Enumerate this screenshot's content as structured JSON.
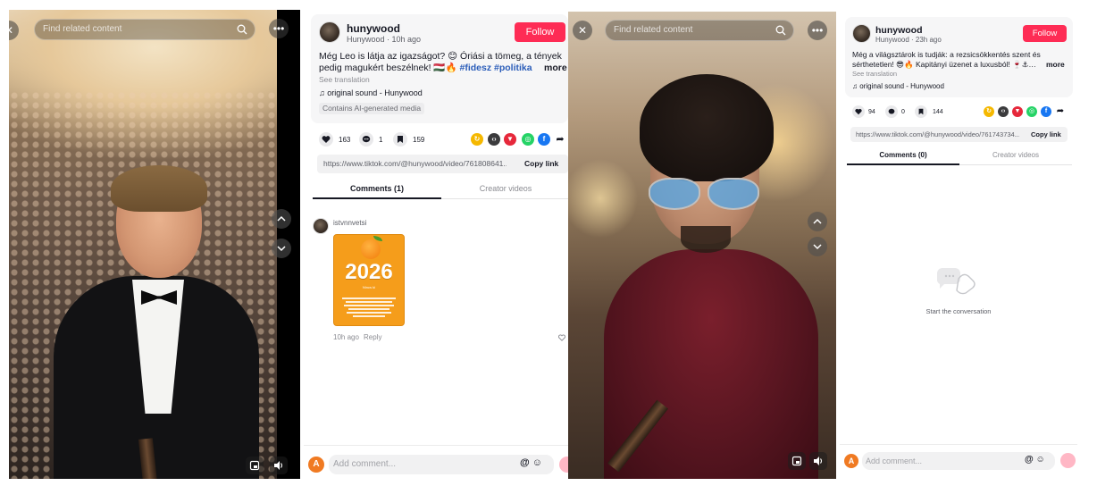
{
  "left": {
    "video": {
      "search_placeholder": "Find related content"
    },
    "author": {
      "name": "hunywood",
      "sub": "Hunywood · 10h ago",
      "follow_label": "Follow"
    },
    "caption": {
      "text": "Még Leo is látja az igazságot? 😊 Óriási a tömeg, a tények pedig magukért beszélnek! 🇭🇺🔥 ",
      "tags": "#fidesz #politika #budapest…",
      "more": "more",
      "see_translation": "See translation"
    },
    "sound": "♫  original sound - Hunywood",
    "ai_label": "Contains AI-generated media",
    "actions": {
      "likes": "163",
      "comments": "1",
      "saves": "159"
    },
    "link": {
      "url": "https://www.tiktok.com/@hunywood/video/761808641...",
      "copy": "Copy link"
    },
    "tabs": [
      "Comments (1)",
      "Creator videos"
    ],
    "comment": {
      "user": "istvnnvetsi",
      "sticker_year": "2026",
      "sticker_small": "Nincs ki",
      "time": "10h ago",
      "reply": "Reply"
    },
    "composer": {
      "avatar": "A",
      "placeholder": "Add comment...",
      "emoji": "@ ☺"
    }
  },
  "right": {
    "video": {
      "search_placeholder": "Find related content"
    },
    "author": {
      "name": "hunywood",
      "sub": "Hunywood · 23h ago",
      "follow_label": "Follow"
    },
    "caption": {
      "text": "Még a világsztárok is tudják: a rezsicsökkentés szent és sérthetetlen! 😎🔥 Kapitányi üzenet a luxusból! 🍷⚓…",
      "more": "more",
      "see_translation": "See translation"
    },
    "sound": "♫  original sound - Hunywood",
    "actions": {
      "likes": "94",
      "comments": "0",
      "saves": "144"
    },
    "link": {
      "url": "https://www.tiktok.com/@hunywood/video/761743734...",
      "copy": "Copy link"
    },
    "tabs": [
      "Comments (0)",
      "Creator videos"
    ],
    "empty_text": "Start the conversation",
    "composer": {
      "avatar": "A",
      "placeholder": "Add comment...",
      "emoji": "@ ☺"
    }
  },
  "icons": {
    "share": [
      "reddit-like-icon",
      "embed-icon",
      "pinterest-icon",
      "whatsapp-icon",
      "facebook-icon",
      "forward-icon"
    ],
    "colors": {
      "accent": "#fe2c55",
      "hashtag": "#2b5db9",
      "share_yellow": "#f5b800",
      "share_dark": "#3b3b3d",
      "share_red": "#e6283b",
      "share_green": "#25d366",
      "share_blue": "#1877f2"
    }
  }
}
